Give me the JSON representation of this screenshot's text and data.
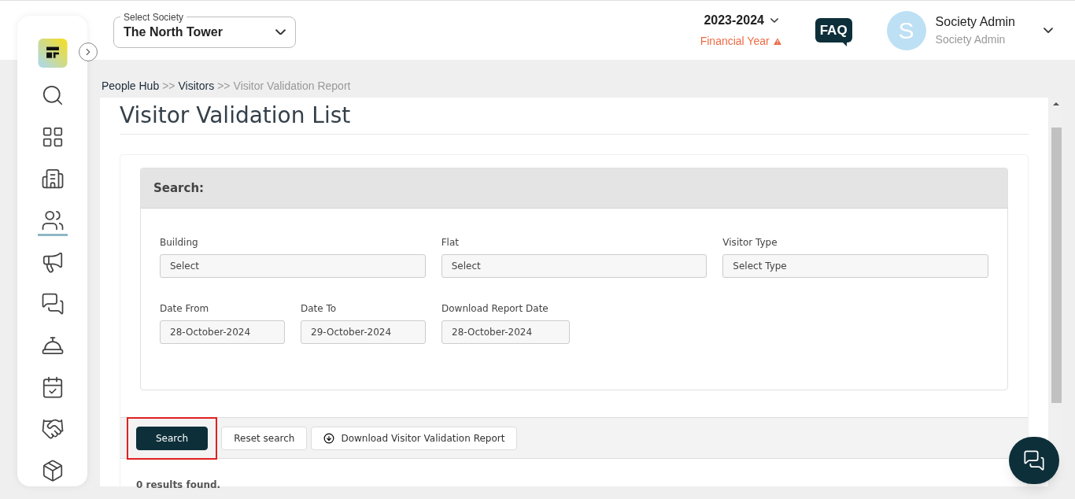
{
  "header": {
    "society_select": {
      "label": "Select Society",
      "value": "The North Tower"
    },
    "financial_year": {
      "value": "2023-2024",
      "label": "Financial Year",
      "warning": true
    },
    "faq": "FAQ",
    "user": {
      "initial": "S",
      "name": "Society Admin",
      "role": "Society Admin"
    }
  },
  "sidebar": {
    "items": [
      {
        "selected": false
      },
      {
        "selected": false
      },
      {
        "selected": false
      },
      {
        "selected": true
      },
      {
        "selected": false
      },
      {
        "selected": false
      },
      {
        "selected": false
      },
      {
        "selected": false
      },
      {
        "selected": false
      },
      {
        "selected": false
      }
    ]
  },
  "breadcrumb": [
    {
      "label": "People Hub",
      "current": false
    },
    {
      "label": "Visitors",
      "current": false
    },
    {
      "label": "Visitor Validation Report",
      "current": true
    }
  ],
  "breadcrumb_separator": ">>",
  "page_title": "Visitor Validation List",
  "search_panel": {
    "title": "Search:",
    "fields": [
      {
        "label": "Building",
        "placeholder": "Select"
      },
      {
        "label": "Flat",
        "placeholder": "Select"
      },
      {
        "label": "Visitor Type",
        "placeholder": "Select Type"
      },
      {
        "label": "Date From",
        "value": "28-October-2024"
      },
      {
        "label": "Date To",
        "value": "29-October-2024"
      },
      {
        "label": "Download Report Date",
        "value": "28-October-2024"
      }
    ]
  },
  "actions": [
    {
      "label": "Search",
      "kind": "primary",
      "highlighted": true
    },
    {
      "label": "Reset search",
      "kind": "secondary",
      "highlighted": false
    },
    {
      "label": "Download Visitor Validation Report",
      "kind": "download",
      "highlighted": false
    }
  ],
  "results": "0 results found."
}
